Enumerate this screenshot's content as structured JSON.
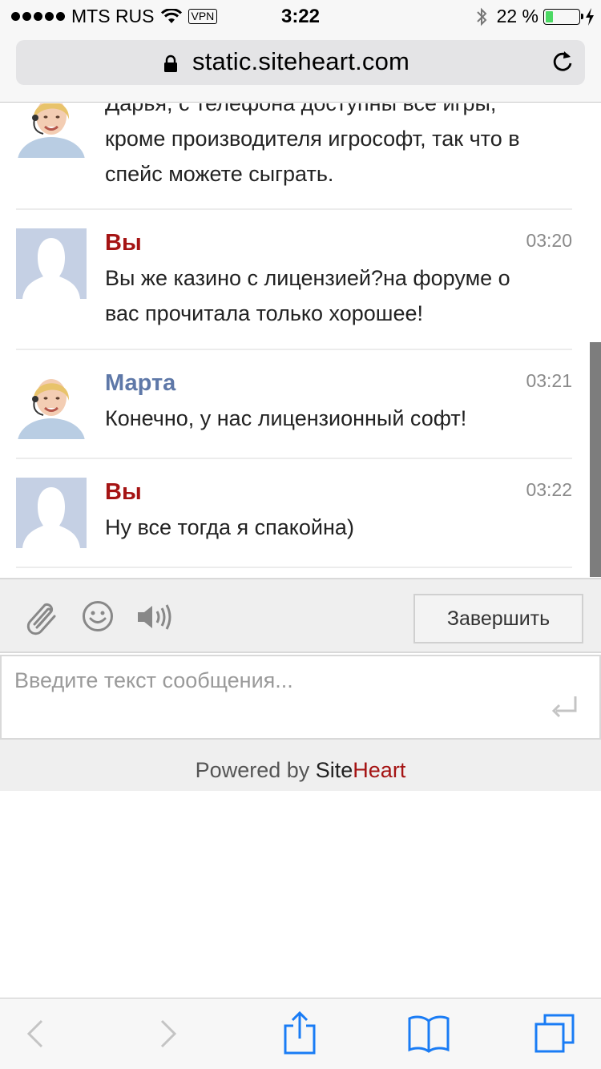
{
  "status_bar": {
    "carrier": "MTS RUS",
    "vpn": "VPN",
    "time": "3:22",
    "battery": "22 %",
    "battery_level": 0.22,
    "signal_icon": "signal-dots-icon",
    "wifi_icon": "wifi-icon",
    "bluetooth_icon": "bluetooth-icon",
    "charging_icon": "bolt-icon"
  },
  "browser": {
    "url": "static.siteheart.com",
    "lock_icon": "lock-icon",
    "reload_icon": "reload-icon"
  },
  "chat": {
    "messages": [
      {
        "author": "",
        "time": "",
        "text": "Дарья, с телефона доступны все игры, кроме производителя игрософт, так что в спейс можете сыграть.",
        "avatar": "operator-avatar"
      },
      {
        "author": "Вы",
        "time": "03:20",
        "text": "Вы же казино с лицензией?на форуме о вас прочитала только хорошее!",
        "avatar": "user-avatar"
      },
      {
        "author": "Марта",
        "time": "03:21",
        "text": "Конечно, у нас лицензионный софт!",
        "avatar": "operator-avatar"
      },
      {
        "author": "Вы",
        "time": "03:22",
        "text": "Ну все тогда я спакойна)",
        "avatar": "user-avatar"
      }
    ],
    "message_lines": {
      "m0": [
        "Дарья, с телефона доступны все игры,",
        "кроме производителя игрософт, так что в",
        "спейс можете сыграть."
      ],
      "m1": [
        "Вы же казино с лицензией?на форуме о",
        "вас прочитала только хорошее!"
      ],
      "m2": [
        "Конечно, у нас лицензионный софт!"
      ],
      "m3": [
        "Ну все тогда я спакойна)"
      ]
    }
  },
  "toolbar": {
    "attach_icon": "paperclip-icon",
    "smile_icon": "smiley-icon",
    "sound_icon": "speaker-icon",
    "finish_label": "Завершить"
  },
  "input": {
    "placeholder": "Введите текст сообщения...",
    "value": "",
    "enter_icon": "enter-icon"
  },
  "footer": {
    "powered_by": "Powered by ",
    "brand_site": "Site",
    "brand_heart": "Heart"
  },
  "safari_bar": {
    "back_icon": "back-chevron-icon",
    "forward_icon": "forward-chevron-icon",
    "share_icon": "share-icon",
    "bookmarks_icon": "bookmarks-icon",
    "tabs_icon": "tabs-icon"
  },
  "colors": {
    "you_author": "#a51414",
    "operator_author": "#5e78a8",
    "battery_fill": "#4cd964",
    "ios_blue": "#1a7cf5"
  }
}
